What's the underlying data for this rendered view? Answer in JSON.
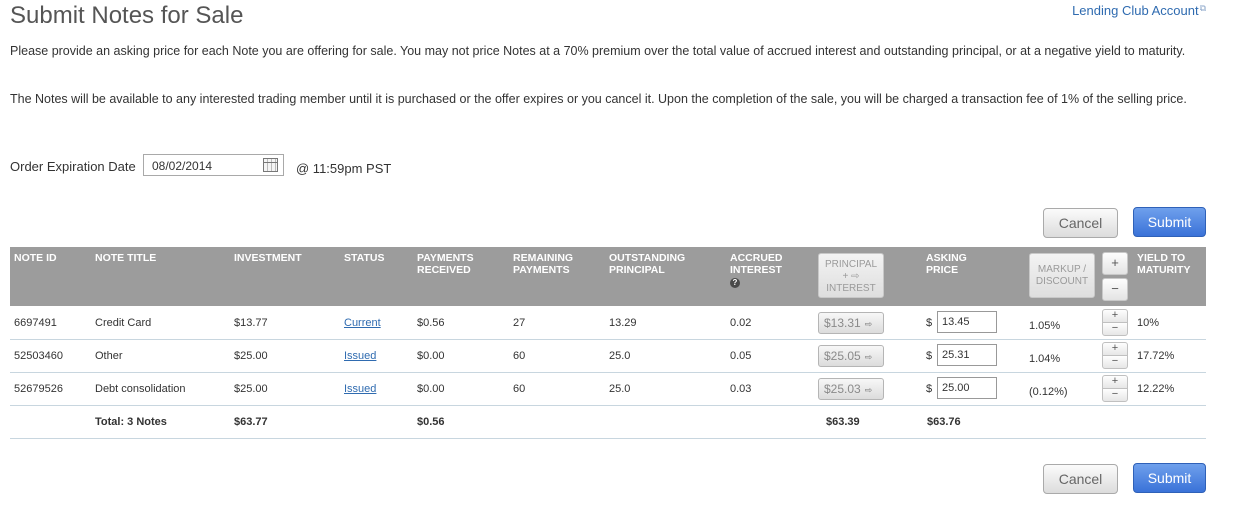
{
  "header": {
    "title": "Submit Notes for Sale",
    "account_link": "Lending Club Account"
  },
  "instructions": {
    "paragraph1": "Please provide an asking price for each Note you are offering for sale. You may not price Notes at a 70% premium over the total value of accrued interest and outstanding principal, or at a negative yield to maturity.",
    "paragraph2": "The Notes will be available to any interested trading member until it is purchased or the offer expires or you cancel it. Upon the completion of the sale, you will be charged a transaction fee of 1% of the selling price."
  },
  "expiration": {
    "label": "Order Expiration Date",
    "date": "08/02/2014",
    "time": "@ 11:59pm PST"
  },
  "buttons": {
    "cancel": "Cancel",
    "submit": "Submit"
  },
  "table": {
    "columns": {
      "note_id": "NOTE ID",
      "note_title": "NOTE TITLE",
      "investment": "INVESTMENT",
      "status": "STATUS",
      "payments_received": "PAYMENTS RECEIVED",
      "remaining_payments": "REMAINING PAYMENTS",
      "outstanding_principal": "OUTSTANDING PRINCIPAL",
      "accrued_interest": "ACCRUED INTEREST",
      "principal_interest_top": "PRINCIPAL",
      "principal_interest_mid": "+ ⇨",
      "principal_interest_bottom": "INTEREST",
      "asking_price": "ASKING PRICE",
      "markup_discount": "MARKUP / DISCOUNT",
      "yield_to_maturity": "YIELD TO MATURITY"
    },
    "rows": [
      {
        "note_id": "6697491",
        "title": "Credit Card",
        "investment": "$13.77",
        "status": "Current",
        "payments_received": "$0.56",
        "remaining_payments": "27",
        "outstanding_principal": "13.29",
        "accrued_interest": "0.02",
        "principal_plus_interest": "$13.31",
        "asking_price": "13.45",
        "markup": "1.05%",
        "ytm": "10%"
      },
      {
        "note_id": "52503460",
        "title": "Other",
        "investment": "$25.00",
        "status": "Issued",
        "payments_received": "$0.00",
        "remaining_payments": "60",
        "outstanding_principal": "25.0",
        "accrued_interest": "0.05",
        "principal_plus_interest": "$25.05",
        "asking_price": "25.31",
        "markup": "1.04%",
        "ytm": "17.72%"
      },
      {
        "note_id": "52679526",
        "title": "Debt consolidation",
        "investment": "$25.00",
        "status": "Issued",
        "payments_received": "$0.00",
        "remaining_payments": "60",
        "outstanding_principal": "25.0",
        "accrued_interest": "0.03",
        "principal_plus_interest": "$25.03",
        "asking_price": "25.00",
        "markup": "(0.12%)",
        "ytm": "12.22%"
      }
    ],
    "totals": {
      "label": "Total: 3 Notes",
      "investment": "$63.77",
      "payments_received": "$0.56",
      "principal_plus_interest": "$63.39",
      "asking_price": "$63.76"
    },
    "currency_symbol": "$"
  },
  "icons": {
    "external_link": "external-link-icon",
    "calendar": "calendar-icon",
    "help": "question-circle-icon",
    "arrow": "arrow-right-icon"
  },
  "colors": {
    "header_bg": "#9c9c9c",
    "link": "#2f6bb0",
    "submit_bg": "#3a72d8"
  }
}
